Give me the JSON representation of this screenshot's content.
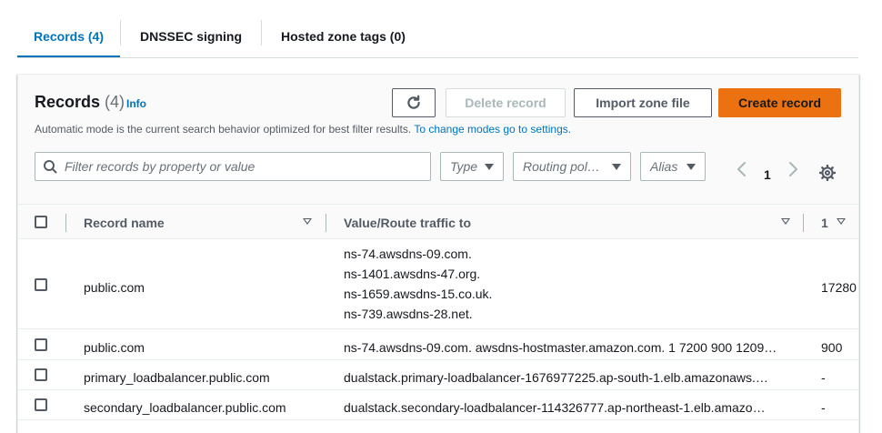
{
  "tabs": [
    {
      "label": "Records (4)",
      "active": true
    },
    {
      "label": "DNSSEC signing",
      "active": false
    },
    {
      "label": "Hosted zone tags (0)",
      "active": false
    }
  ],
  "panel": {
    "title": "Records",
    "count": "(4)",
    "info": "Info",
    "description": "Automatic mode is the current search behavior optimized for best filter results.",
    "description_link": "To change modes go to settings.",
    "buttons": {
      "refresh_icon": "refresh-icon",
      "delete": "Delete record",
      "import": "Import zone file",
      "create": "Create record"
    },
    "filter_placeholder": "Filter records by property or value",
    "selects": {
      "type": "Type",
      "routing": "Routing pol…",
      "alias": "Alias"
    },
    "pagination": {
      "page": "1"
    }
  },
  "table": {
    "columns": {
      "name": "Record name",
      "value": "Value/Route traffic to",
      "ttl": "1"
    },
    "rows": [
      {
        "name": "public.com",
        "values": [
          "ns-74.awsdns-09.com.",
          "ns-1401.awsdns-47.org.",
          "ns-1659.awsdns-15.co.uk.",
          "ns-739.awsdns-28.net."
        ],
        "ttl": "17280"
      },
      {
        "name": "public.com",
        "values": [
          "ns-74.awsdns-09.com. awsdns-hostmaster.amazon.com. 1 7200 900 1209…"
        ],
        "ttl": "900"
      },
      {
        "name": "primary_loadbalancer.public.com",
        "values": [
          "dualstack.primary-loadbalancer-1676977225.ap-south-1.elb.amazonaws.…"
        ],
        "ttl": "-"
      },
      {
        "name": "secondary_loadbalancer.public.com",
        "values": [
          "dualstack.secondary-loadbalancer-114326777.ap-northeast-1.elb.amazo…"
        ],
        "ttl": "-"
      }
    ]
  },
  "colors": {
    "accent": "#0073bb",
    "primary_button": "#ec7211"
  }
}
